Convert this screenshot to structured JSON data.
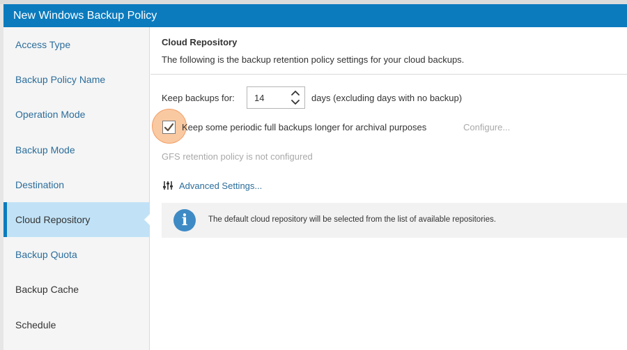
{
  "window": {
    "title": "New Windows Backup Policy"
  },
  "sidebar": {
    "items": [
      {
        "label": "Access Type"
      },
      {
        "label": "Backup Policy Name"
      },
      {
        "label": "Operation Mode"
      },
      {
        "label": "Backup Mode"
      },
      {
        "label": "Destination"
      },
      {
        "label": "Cloud Repository",
        "active": true
      },
      {
        "label": "Backup Quota"
      },
      {
        "label": "Backup Cache"
      },
      {
        "label": "Schedule"
      }
    ]
  },
  "main": {
    "title": "Cloud Repository",
    "description": "The following is the backup retention policy settings for your cloud backups.",
    "keep_label": "Keep backups for:",
    "keep_value": "14",
    "days_label": "days (excluding days with no backup)",
    "archival_checkbox": {
      "label": "Keep some periodic full backups longer for archival purposes",
      "checked": true
    },
    "configure_label": "Configure...",
    "gfs_status": "GFS retention policy is not configured",
    "advanced_settings": "Advanced Settings...",
    "info_icon_glyph": "i",
    "info_text": "The default cloud repository will be selected from the list of available repositories."
  },
  "colors": {
    "titlebar": "#0b7bbe",
    "active_nav": "#c1e2f6",
    "link": "#2b6d9b",
    "info_icon": "#3e8ac5",
    "highlight": "#f7b47e"
  },
  "icons": {
    "spinner": "chevron-up-down-icon",
    "checkbox": "checkmark-icon",
    "advanced": "sliders-icon",
    "info": "info-icon"
  }
}
